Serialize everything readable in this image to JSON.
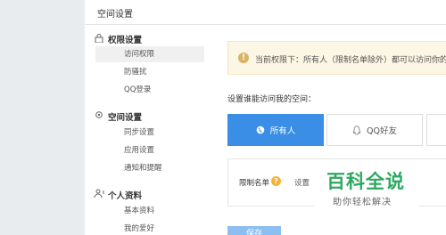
{
  "header": {
    "title": "空间设置"
  },
  "sidebar": {
    "sections": [
      {
        "title": "权限设置",
        "icon": "lock-icon",
        "items": [
          "访问权限",
          "防骚扰",
          "QQ登录"
        ]
      },
      {
        "title": "空间设置",
        "icon": "gear-icon",
        "items": [
          "同步设置",
          "应用设置",
          "通知和提醒"
        ]
      },
      {
        "title": "个人资料",
        "icon": "user-icon",
        "items": [
          "基本资料",
          "我的爱好"
        ]
      }
    ]
  },
  "main": {
    "notice": "当前权限下：所有人（限制名单除外）都可以访问你的空",
    "section_label": "设置谁能访问我的空间：",
    "options": {
      "all": "所有人",
      "qq": "QQ好友"
    },
    "limit": {
      "label": "限制名单",
      "setting": "设置"
    },
    "save": "保存"
  },
  "watermark": {
    "title": "百科全说",
    "subtitle": "助你轻松解决"
  },
  "colors": {
    "accent": "#3a8ee6",
    "notice_bg": "#fcf6e4",
    "watermark": "#2ea860"
  }
}
